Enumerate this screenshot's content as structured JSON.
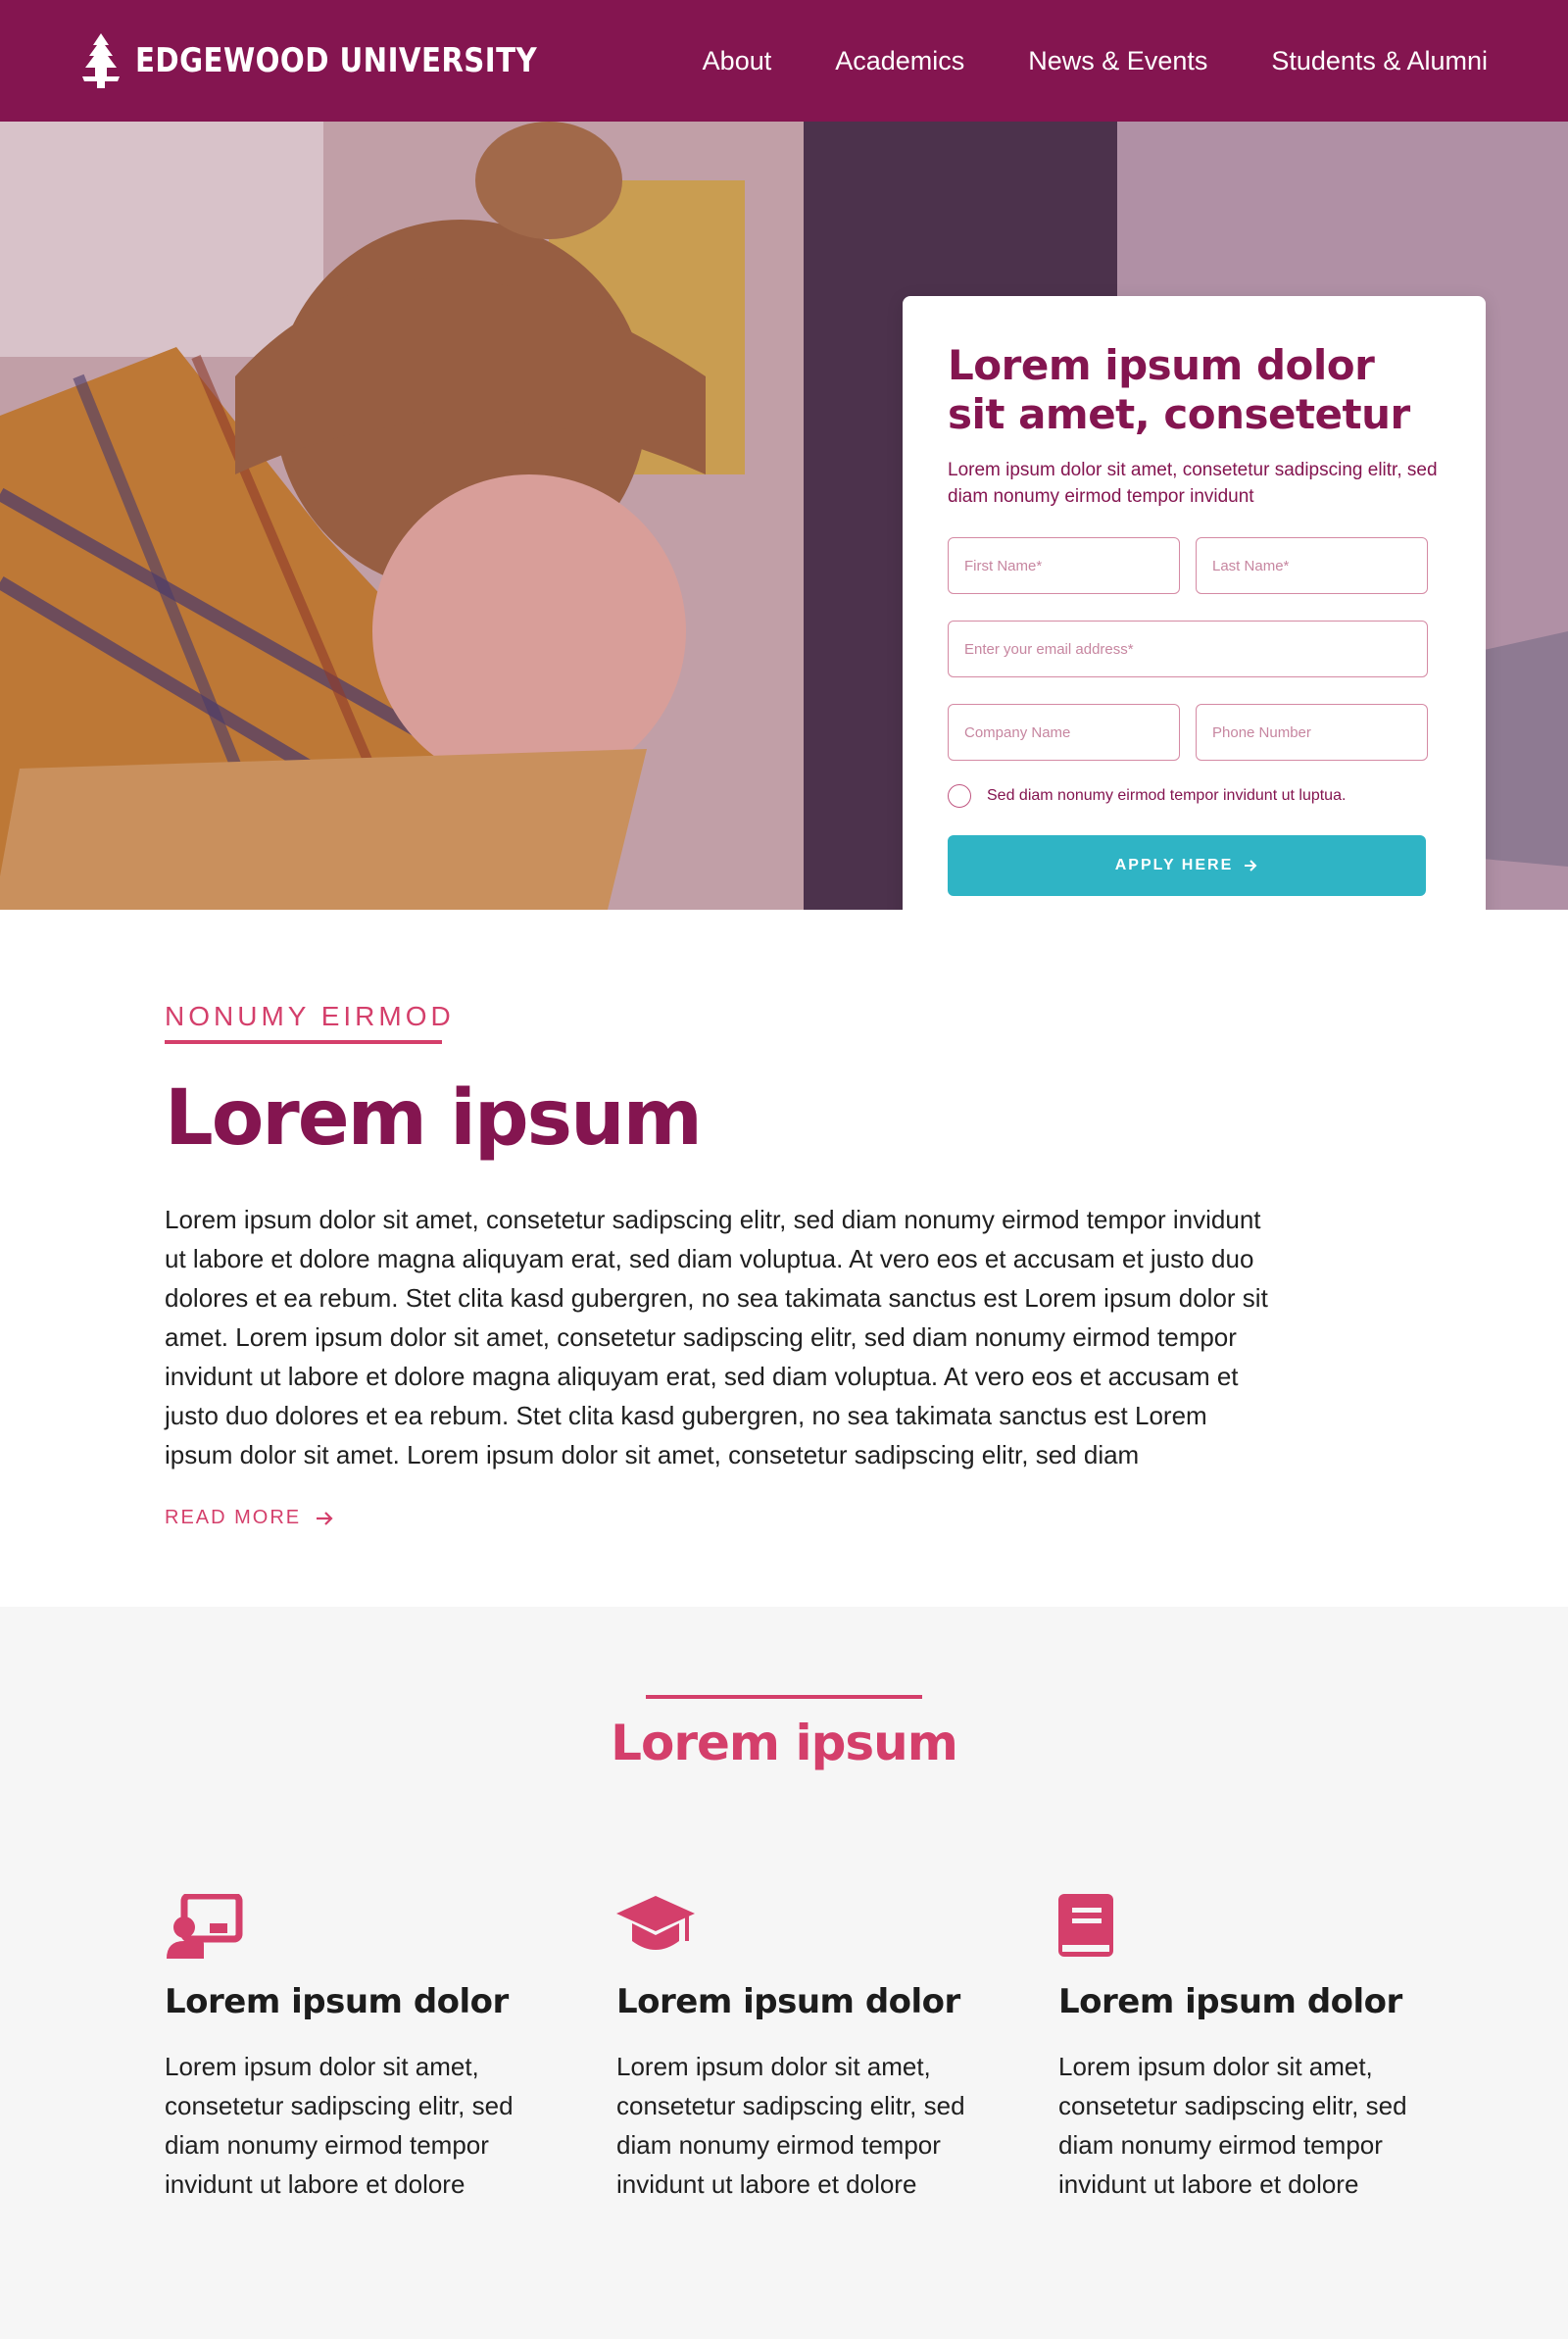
{
  "nav": {
    "brand": "EDGEWOOD UNIVERSITY",
    "logo_icon": "tree-icon",
    "links": [
      "About",
      "Academics",
      "News & Events",
      "Students & Alumni"
    ]
  },
  "hero": {
    "form": {
      "title_line1": "Lorem ipsum dolor",
      "title_line2": "sit amet, consetetur",
      "subtitle": "Lorem ipsum dolor sit amet, consetetur sadipscing elitr, sed diam nonumy eirmod tempor invidunt",
      "first_name_placeholder": "First Name*",
      "last_name_placeholder": "Last Name*",
      "email_placeholder": "Enter your email address*",
      "company_placeholder": "Company Name",
      "phone_placeholder": "Phone Number",
      "consent_label": "Sed diam nonumy eirmod tempor invidunt ut luptua.",
      "submit_label": "APPLY HERE",
      "submit_icon": "arrow-right-icon"
    }
  },
  "about": {
    "eyebrow": "NONUMY EIRMOD",
    "title": "Lorem ipsum",
    "body": "Lorem ipsum dolor sit amet, consetetur sadipscing elitr, sed diam nonumy eirmod tempor invidunt ut labore et dolore magna aliquyam erat, sed diam voluptua. At vero eos et accusam et justo duo dolores et ea rebum. Stet clita kasd gubergren, no sea takimata sanctus est Lorem ipsum dolor sit amet. Lorem ipsum dolor sit amet, consetetur sadipscing elitr, sed diam nonumy eirmod tempor invidunt ut labore et dolore magna aliquyam erat, sed diam voluptua. At vero eos et accusam et justo duo dolores et ea rebum. Stet clita kasd gubergren, no sea takimata sanctus est Lorem ipsum dolor sit amet. Lorem ipsum dolor sit amet, consetetur sadipscing elitr, sed diam",
    "read_more": "READ MORE"
  },
  "features": {
    "title": "Lorem ipsum",
    "items": [
      {
        "icon": "teacher-presentation-icon",
        "heading": "Lorem ipsum dolor",
        "body": "Lorem ipsum dolor sit amet, consetetur sadipscing elitr, sed diam nonumy eirmod tempor invidunt ut labore et dolore"
      },
      {
        "icon": "graduation-cap-icon",
        "heading": "Lorem ipsum dolor",
        "body": "Lorem ipsum dolor sit amet, consetetur sadipscing elitr, sed diam nonumy eirmod tempor invidunt ut labore et dolore"
      },
      {
        "icon": "book-icon",
        "heading": "Lorem ipsum dolor",
        "body": "Lorem ipsum dolor sit amet, consetetur sadipscing elitr, sed diam nonumy eirmod tempor invidunt ut labore et dolore"
      }
    ]
  },
  "colors": {
    "brand_primary": "#841550",
    "accent_pink": "#d43f6b",
    "button_teal": "#2fb4c5",
    "section_gray": "#f6f6f6"
  }
}
